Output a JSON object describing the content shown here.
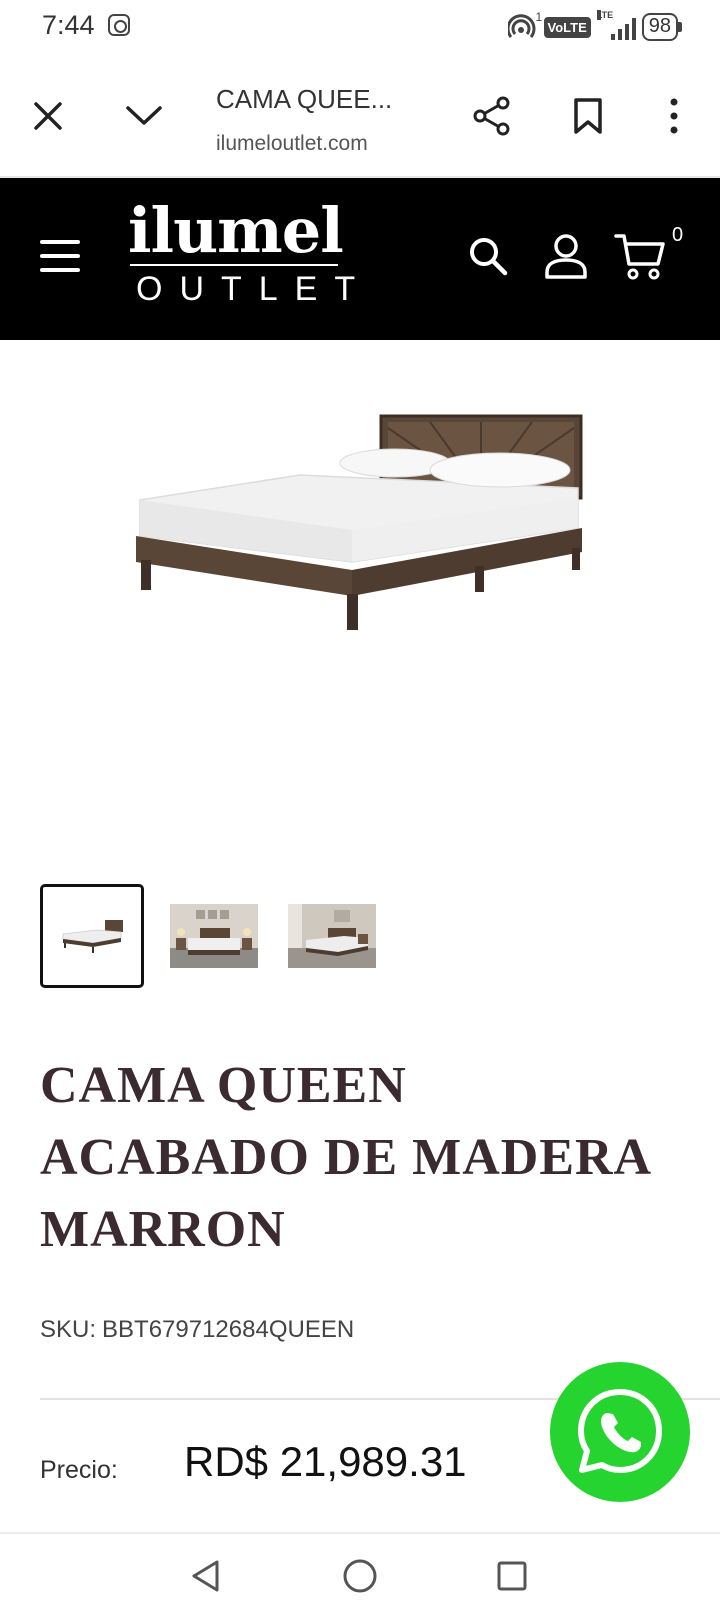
{
  "status_bar": {
    "time": "7:44",
    "network": "VoLTE",
    "lte": "LTE",
    "sim_number": "1",
    "battery": "98"
  },
  "browser": {
    "page_title": "CAMA QUEE...",
    "url": "ilumeloutlet.com"
  },
  "site_header": {
    "logo_main": "ilumel",
    "logo_sub": "OUTLET",
    "cart_count": "0"
  },
  "product": {
    "title_lines": [
      "CAMA QUEEN",
      "ACABADO DE MADERA",
      "MARRON"
    ],
    "sku_label": "SKU:",
    "sku_value": "BBT679712684QUEEN",
    "price_label": "Precio:",
    "price_value": "RD$ 21,989.31"
  },
  "colors": {
    "header_bg": "#000000",
    "title_color": "#3b2a30",
    "whatsapp_green": "#25d42e",
    "wood_dark": "#4a3a2e"
  }
}
